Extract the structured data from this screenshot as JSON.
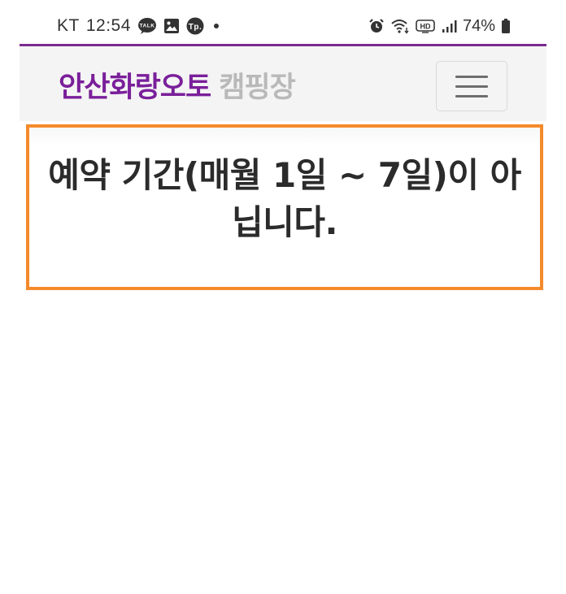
{
  "status_bar": {
    "carrier": "KT",
    "time": "12:54",
    "notification_icons": [
      "talk-icon",
      "image-icon",
      "tp-icon",
      "dot-icon"
    ],
    "system_icons": [
      "alarm-icon",
      "wifi-icon",
      "hd-icon",
      "signal-icon",
      "battery-icon"
    ],
    "battery": "74%",
    "battery_level": 0.74,
    "talk_label": "TALK",
    "tp_label": "Tp.",
    "hd_label": "HD"
  },
  "navbar": {
    "brand_main": "안산화랑오토",
    "brand_sub": "캠핑장",
    "menu_icon": "hamburger-icon",
    "accent_color": "#7a1f9a"
  },
  "notice": {
    "message": "예약 기간(매월 1일 ~ 7일)이 아닙니다.",
    "border_color": "#f58a2b"
  }
}
